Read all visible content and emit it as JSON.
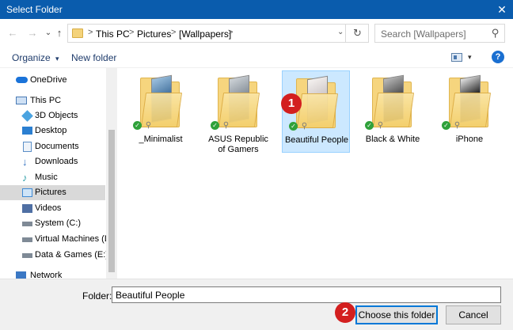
{
  "window": {
    "title": "Select Folder",
    "close_glyph": "✕"
  },
  "nav": {
    "back_glyph": "←",
    "forward_glyph": "→",
    "dropdown_glyph": "⌄",
    "up_glyph": "↑",
    "breadcrumbs": [
      "This PC",
      "Pictures",
      "[Wallpapers]"
    ],
    "separator": ">",
    "refresh_glyph": "↻",
    "search_placeholder": "Search [Wallpapers]",
    "search_glyph": "⚲"
  },
  "toolbar": {
    "organize": "Organize",
    "organize_caret": "▾",
    "new_folder": "New folder",
    "help": "?",
    "view_caret": "▾"
  },
  "sidebar": {
    "items": [
      {
        "label": "OneDrive",
        "icon": "cloud-icon",
        "color": "#1a73d9",
        "indent": 0
      },
      {
        "label": "This PC",
        "icon": "computer-icon",
        "color": "#4a7bb5",
        "indent": 0
      },
      {
        "label": "3D Objects",
        "icon": "cube-icon",
        "color": "#4aa3e0",
        "indent": 1
      },
      {
        "label": "Desktop",
        "icon": "desktop-icon",
        "color": "#2b7fd1",
        "indent": 1
      },
      {
        "label": "Documents",
        "icon": "documents-icon",
        "color": "#5b8fc7",
        "indent": 1
      },
      {
        "label": "Downloads",
        "icon": "download-icon",
        "color": "#2f6fbf",
        "indent": 1
      },
      {
        "label": "Music",
        "icon": "music-icon",
        "color": "#2e9fa8",
        "indent": 1
      },
      {
        "label": "Pictures",
        "icon": "pictures-icon",
        "color": "#3f8ad4",
        "indent": 1,
        "selected": true
      },
      {
        "label": "Videos",
        "icon": "videos-icon",
        "color": "#4f6fa3",
        "indent": 1
      },
      {
        "label": "System (C:)",
        "icon": "drive-icon",
        "color": "#7f8a96",
        "indent": 1
      },
      {
        "label": "Virtual Machines (D:)",
        "icon": "drive-icon",
        "color": "#7f8a96",
        "indent": 1
      },
      {
        "label": "Data & Games (E:)",
        "icon": "drive-icon",
        "color": "#7f8a96",
        "indent": 1
      },
      {
        "label": "Network",
        "icon": "network-icon",
        "color": "#3b78c4",
        "indent": 0
      }
    ]
  },
  "folders": [
    {
      "name": "_Minimalist",
      "photo": "#2f5f8f",
      "photo2": "#9fc3e0"
    },
    {
      "name": "ASUS Republic of Gamers",
      "photo": "#7b8590",
      "photo2": "#cfd4d8"
    },
    {
      "name": "Beautiful People",
      "photo": "#c9c1c2",
      "photo2": "#f5f2f0",
      "selected": true
    },
    {
      "name": "Black & White",
      "photo": "#333333",
      "photo2": "#bcbcbc"
    },
    {
      "name": "iPhone",
      "photo": "#1a1a1a",
      "photo2": "#e6e6e6"
    }
  ],
  "badges": {
    "one": "1",
    "two": "2",
    "color": "#d31f1f"
  },
  "bottom": {
    "folder_label": "Folder:",
    "folder_value": "Beautiful People",
    "choose_button": "Choose this folder",
    "cancel_button": "Cancel"
  },
  "colors": {
    "titlebar": "#0a5cad",
    "selection": "#cce8ff",
    "accent": "#0078d7"
  }
}
